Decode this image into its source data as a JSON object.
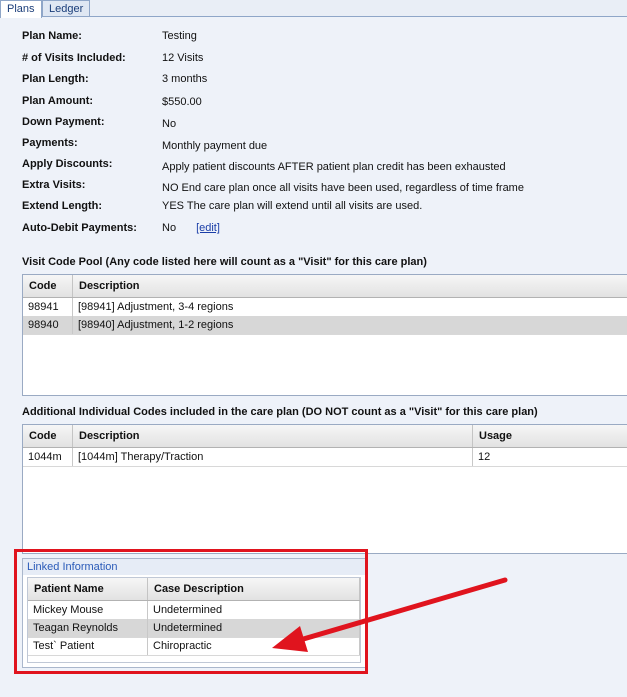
{
  "tabs": [
    "Plans",
    "Ledger"
  ],
  "plan": [
    {
      "label": "Plan Name:",
      "value": "Testing"
    },
    {
      "label": "# of Visits Included:",
      "value": "12 Visits"
    },
    {
      "label": "Plan Length:",
      "value": "3 months"
    },
    {
      "label": "Plan Amount:",
      "value": "$550.00"
    },
    {
      "label": "Down Payment:",
      "value": "No"
    },
    {
      "label": "Payments:",
      "value": "Monthly payment due"
    },
    {
      "label": "Apply Discounts:",
      "value": "Apply patient discounts AFTER patient plan credit has been exhausted"
    },
    {
      "label": "Extra Visits:",
      "value": "NO  End care plan once all visits have been used, regardless of time frame"
    },
    {
      "label": "Extend Length:",
      "value": "YES  The care plan will extend until all visits are used."
    },
    {
      "label": "Auto-Debit Payments:",
      "value": "No",
      "link": "[edit]"
    }
  ],
  "visit_pool": {
    "title": "Visit Code Pool (Any code listed here will count as a \"Visit\" for this care plan)",
    "columns": [
      "Code",
      "Description"
    ],
    "rows": [
      [
        "98941",
        "[98941] Adjustment, 3-4 regions"
      ],
      [
        "98940",
        "[98940] Adjustment, 1-2 regions"
      ]
    ]
  },
  "additional": {
    "title": "Additional Individual Codes included in the care plan (DO NOT count as a \"Visit\" for this care plan)",
    "columns": [
      "Code",
      "Description",
      "Usage"
    ],
    "rows": [
      [
        "1044m",
        "[1044m] Therapy/Traction",
        "12"
      ]
    ]
  },
  "linked": {
    "title": "Linked Information",
    "columns": [
      "Patient Name",
      "Case Description"
    ],
    "rows": [
      [
        "Mickey  Mouse",
        "Undetermined"
      ],
      [
        "Teagan Reynolds",
        "Undetermined"
      ],
      [
        "Test` Patient",
        "Chiropractic"
      ]
    ]
  },
  "colors": {
    "highlight": "#e0141e",
    "link": "#1a3ea8",
    "alt_row": "#d7d7d7"
  }
}
